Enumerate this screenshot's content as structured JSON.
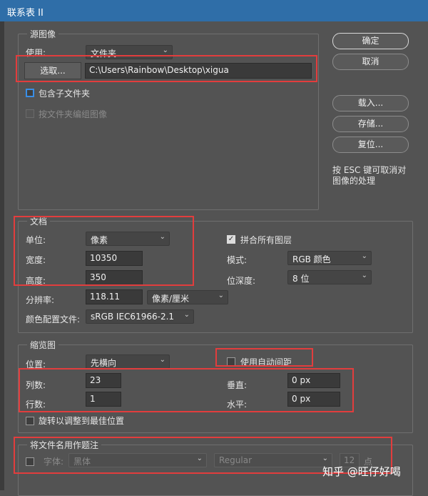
{
  "window": {
    "title": "联系表 II"
  },
  "source": {
    "group_label": "源图像",
    "use_label": "使用:",
    "use_value": "文件夹",
    "choose_button": "选取...",
    "path": "C:\\Users\\Rainbow\\Desktop\\xigua",
    "include_subfolders": "包含子文件夹",
    "group_by_folder": "按文件夹编组图像"
  },
  "actions": {
    "ok": "确定",
    "cancel": "取消",
    "load": "载入...",
    "save": "存储...",
    "reset": "复位...",
    "hint": "按 ESC 键可取消对图像的处理"
  },
  "document": {
    "group_label": "文档",
    "unit_label": "单位:",
    "unit_value": "像素",
    "width_label": "宽度:",
    "width_value": "10350",
    "height_label": "高度:",
    "height_value": "350",
    "resolution_label": "分辨率:",
    "resolution_value": "118.11",
    "resolution_unit": "像素/厘米",
    "color_profile_label": "颜色配置文件:",
    "color_profile_value": "sRGB IEC61966-2.1",
    "flatten_label": "拼合所有图层",
    "mode_label": "模式:",
    "mode_value": "RGB 颜色",
    "bitdepth_label": "位深度:",
    "bitdepth_value": "8 位"
  },
  "thumbnails": {
    "group_label": "缩览图",
    "place_label": "位置:",
    "place_value": "先横向",
    "auto_spacing": "使用自动间距",
    "columns_label": "列数:",
    "columns_value": "23",
    "rows_label": "行数:",
    "rows_value": "1",
    "vertical_label": "垂直:",
    "vertical_value": "0 px",
    "horizontal_label": "水平:",
    "horizontal_value": "0 px",
    "rotate_label": "旋转以调整到最佳位置"
  },
  "caption": {
    "group_label": "将文件名用作题注",
    "font_label": "字体:",
    "font_value": "黑体",
    "style_value": "Regular",
    "size_value": "12",
    "size_unit": "点"
  },
  "watermark": "知乎 @旺仔好喝"
}
